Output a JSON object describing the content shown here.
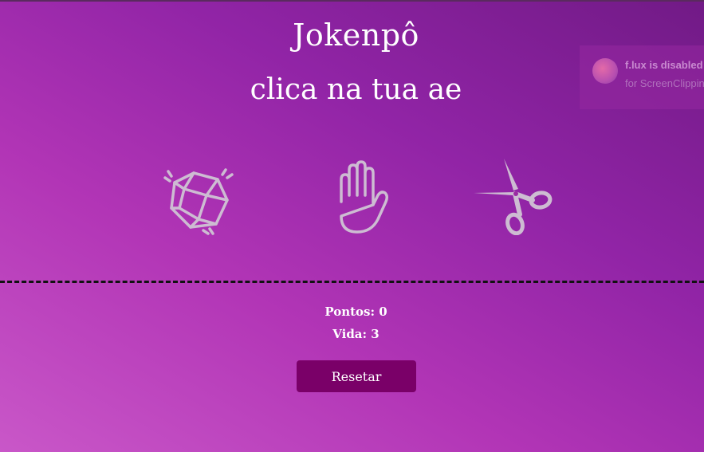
{
  "game": {
    "title": "Jokenpô",
    "subtitle": "clica na tua ae"
  },
  "choices": [
    {
      "id": "rock",
      "icon": "rock-crystal-icon"
    },
    {
      "id": "paper",
      "icon": "open-hand-icon"
    },
    {
      "id": "scissors",
      "icon": "scissors-icon"
    }
  ],
  "score": {
    "points_text": "Pontos: 0",
    "lives_text": "Vida: 3"
  },
  "controls": {
    "reset_label": "Resetar"
  },
  "notification": {
    "title": "f.lux is disabled",
    "subtitle": "for ScreenClipping"
  },
  "colors": {
    "icon_stroke": "#cdbcd2",
    "reset_button_bg": "#7a0068",
    "divider": "#111111",
    "bg_light": "#c957c8",
    "bg_dark": "#711a86"
  }
}
